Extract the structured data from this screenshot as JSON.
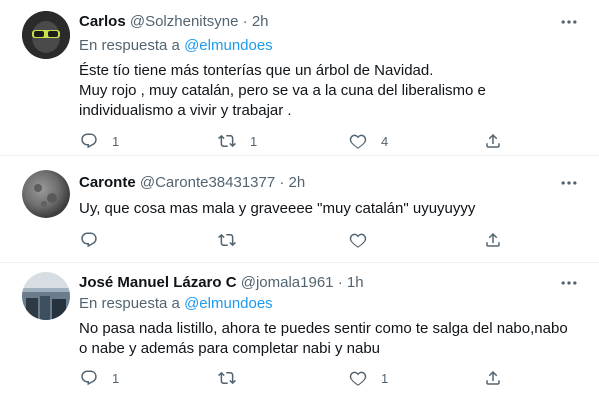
{
  "tweets": [
    {
      "name": "Carlos",
      "handle": "@Solzhenitsyne",
      "dot": "·",
      "time": "2h",
      "reply_prefix": "En respuesta a",
      "reply_mention": "@elmundoes",
      "text": "Éste tío tiene más tonterías que un árbol de Navidad.\nMuy rojo , muy catalán, pero se va a la cuna del liberalismo e individualismo a vivir y trabajar .",
      "replies": "1",
      "retweets": "1",
      "likes": "4"
    },
    {
      "name": "Caronte",
      "handle": "@Caronte38431377",
      "dot": "·",
      "time": "2h",
      "text": "Uy, que cosa mas mala y graveeee \"muy catalán\" uyuyuyyy",
      "replies": "",
      "retweets": "",
      "likes": ""
    },
    {
      "name": "José Manuel Lázaro C",
      "handle": "@jomala1961",
      "dot": "·",
      "time": "1h",
      "reply_prefix": "En respuesta a",
      "reply_mention": "@elmundoes",
      "text": "No pasa nada listillo, ahora te puedes sentir como te salga del nabo,nabo o nabe y además para completar nabi y nabu",
      "replies": "1",
      "retweets": "",
      "likes": "1"
    }
  ],
  "icons": {
    "reply": "reply-icon",
    "retweet": "retweet-icon",
    "like": "heart-icon",
    "share": "share-icon",
    "more": "more-icon"
  },
  "colors": {
    "secondary_text": "#536471",
    "mention": "#1d9bf0",
    "divider": "#eff3f4"
  }
}
